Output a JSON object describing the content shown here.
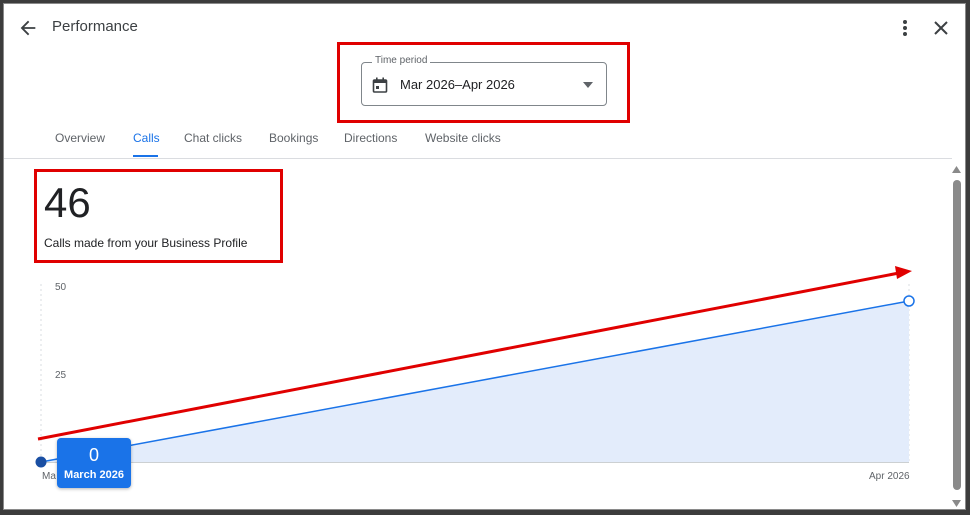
{
  "header": {
    "title": "Performance",
    "back_icon": "arrow-back-icon",
    "more_icon": "more-vert-icon",
    "close_icon": "close-icon"
  },
  "time_period": {
    "label": "Time period",
    "value": "Mar 2026–Apr 2026",
    "icon": "calendar-icon"
  },
  "tabs": [
    {
      "label": "Overview",
      "active": false
    },
    {
      "label": "Calls",
      "active": true
    },
    {
      "label": "Chat clicks",
      "active": false
    },
    {
      "label": "Bookings",
      "active": false
    },
    {
      "label": "Directions",
      "active": false
    },
    {
      "label": "Website clicks",
      "active": false
    }
  ],
  "summary": {
    "count": "46",
    "caption": "Calls made from your Business Profile"
  },
  "chart_data": {
    "type": "area",
    "x": [
      "Mar 2026",
      "Apr 2026"
    ],
    "y_ticks": [
      "50",
      "25"
    ],
    "ylim": [
      0,
      50
    ],
    "series": [
      {
        "values": [
          0,
          46
        ]
      }
    ],
    "x_tick_labels": [
      "Ma",
      "Apr 2026"
    ],
    "colors": {
      "line": "#1a73e8",
      "fill": "#e3ecfb"
    }
  },
  "tooltip": {
    "value": "0",
    "label": "March 2026"
  },
  "colors": {
    "accent": "#1a73e8",
    "annotation": "#e00000"
  }
}
